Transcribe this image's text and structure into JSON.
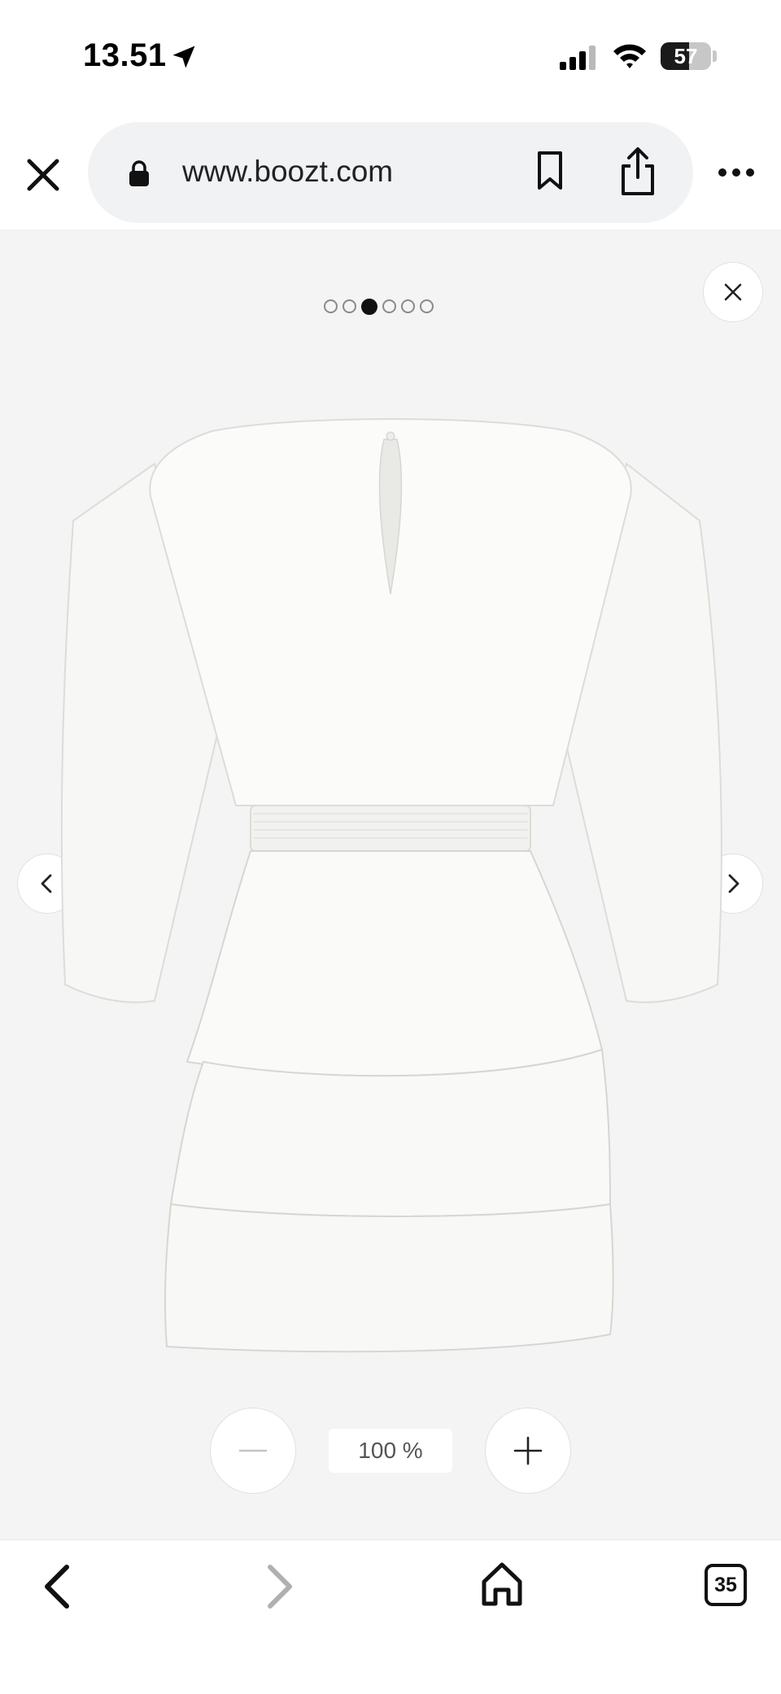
{
  "status_bar": {
    "time": "13.51",
    "battery": {
      "label": "57",
      "level": 0.57
    },
    "icons": [
      "location-arrow-icon",
      "cellular-signal-icon",
      "wifi-icon",
      "battery-icon"
    ]
  },
  "browser": {
    "url": "www.boozt.com",
    "icons": [
      "close-icon",
      "lock-icon",
      "bookmark-icon",
      "share-icon",
      "more-icon"
    ]
  },
  "gallery": {
    "image_count": 6,
    "active_index": 2,
    "product": "white tiered long-sleeve dress (back view)",
    "icons": [
      "close-icon",
      "chevron-left-icon",
      "chevron-right-icon"
    ]
  },
  "zoom": {
    "level_label": "100 %",
    "icons": [
      "minus-icon",
      "plus-icon"
    ]
  },
  "bottom_bar": {
    "tab_count": "35",
    "icons": [
      "back-arrow-icon",
      "forward-arrow-icon",
      "home-icon",
      "tabs-icon"
    ]
  },
  "colors": {
    "gallery_bg": "#f4f4f4",
    "active_dot": "#111111",
    "inactive_dot": "#8a8a8a",
    "disabled_icon": "#b0b0b0"
  }
}
